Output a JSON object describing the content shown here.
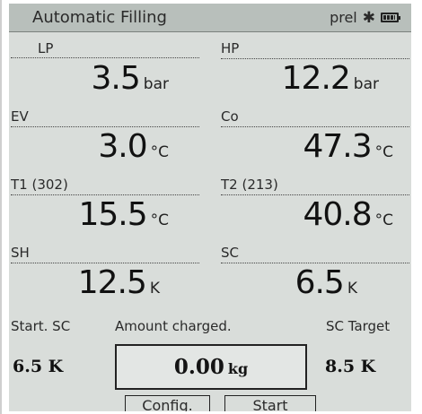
{
  "header": {
    "title": "Automatic Filling",
    "status_text": "prel",
    "bluetooth_icon": "bluetooth-icon",
    "battery_icon": "battery-icon"
  },
  "readings": [
    {
      "label": "LP",
      "value": "3.5",
      "unit": "bar"
    },
    {
      "label": "HP",
      "value": "12.2",
      "unit": "bar"
    },
    {
      "label": "EV",
      "value": "3.0",
      "unit": "°C"
    },
    {
      "label": "Co",
      "value": "47.3",
      "unit": "°C"
    },
    {
      "label": "T1 (302)",
      "value": "15.5",
      "unit": "°C"
    },
    {
      "label": "T2 (213)",
      "value": "40.8",
      "unit": "°C"
    },
    {
      "label": "SH",
      "value": "12.5",
      "unit": "K"
    },
    {
      "label": "SC",
      "value": "6.5",
      "unit": "K"
    }
  ],
  "bottom": {
    "start_sc_label": "Start. SC",
    "start_sc_value": "6.5 K",
    "amount_label": "Amount charged.",
    "amount_value": "0.00",
    "amount_unit": "kg",
    "sc_target_label": "SC Target",
    "sc_target_value": "8.5 K"
  },
  "softkeys": {
    "config": "Config.",
    "start": "Start"
  },
  "colors": {
    "screen_bg": "#d9ddda",
    "titlebar_bg": "#b8bfbb",
    "text": "#141414"
  }
}
